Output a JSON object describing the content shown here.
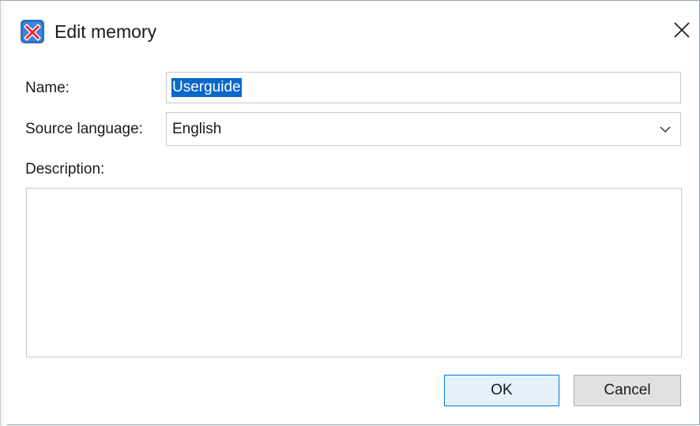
{
  "window": {
    "title": "Edit memory",
    "app_icon": "app-logo-icon",
    "close_icon": "close-icon"
  },
  "form": {
    "name_label": "Name:",
    "name_value": "Userguide",
    "source_language_label": "Source language:",
    "source_language_value": "English",
    "description_label": "Description:",
    "description_value": ""
  },
  "buttons": {
    "ok_label": "OK",
    "cancel_label": "Cancel"
  },
  "colors": {
    "selection": "#0b67c9",
    "ok_border": "#0078d7",
    "ok_bg": "#e5f1fb",
    "icon_bg": "#2f6fc5",
    "icon_x": "#e8242a"
  }
}
